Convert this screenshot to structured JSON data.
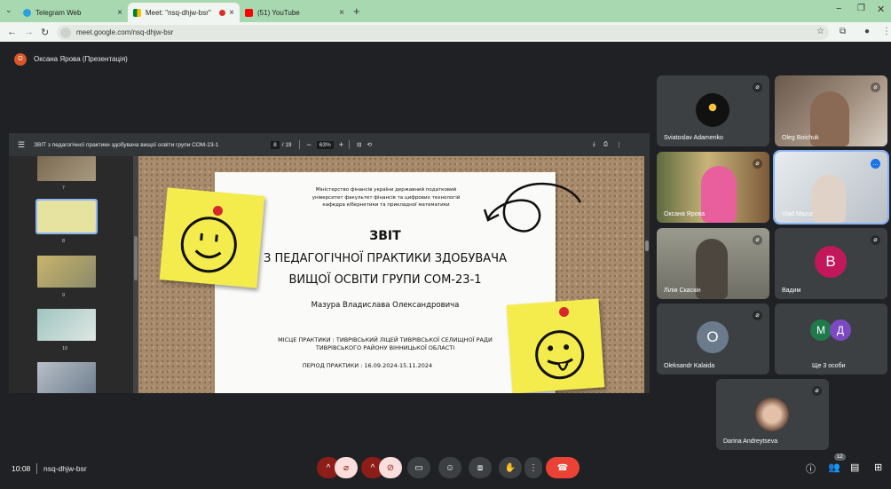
{
  "browser": {
    "tabs": [
      {
        "label": "Telegram Web",
        "icon": "telegram-icon",
        "color": "#2aa1da"
      },
      {
        "label": "Meet: \"nsq-dhjw-bsr\"",
        "icon": "meet-icon",
        "color": "#00832d"
      },
      {
        "label": "(51) YouTube",
        "icon": "youtube-icon",
        "color": "#ff0000"
      }
    ],
    "url": "meet.google.com/nsq-dhjw-bsr"
  },
  "meet": {
    "presenter_initial": "О",
    "presenter_label": "Оксана Ярова (Презентація)",
    "clock": "10:08",
    "meeting_code": "nsq-dhjw-bsr",
    "people_count": "12",
    "participants": [
      {
        "name": "Sviatoslav Adamenko",
        "kind": "avatar"
      },
      {
        "name": "Oleg Boichuk",
        "kind": "video"
      },
      {
        "name": "Оксана Ярова",
        "kind": "video"
      },
      {
        "name": "Vlad Mazur",
        "kind": "video"
      },
      {
        "name": "Лілія Скаскін",
        "kind": "video"
      },
      {
        "name": "Вадим",
        "kind": "letter",
        "letter": "В",
        "color": "#c2185b"
      },
      {
        "name": "Oleksandr Kalaida",
        "kind": "letter",
        "letter": "O",
        "color": "#6b7b8c"
      },
      {
        "name": "Ще 3 особи",
        "kind": "group",
        "letters": [
          "М",
          "Д"
        ]
      },
      {
        "name": "Darina Andreytseva",
        "kind": "avatar"
      }
    ]
  },
  "pdf": {
    "title": "ЗВІТ з педагогічної практики здобувача вищої освіти групи СОМ-23-1",
    "page_current": "8",
    "page_total": "/ 19",
    "zoom": "63%",
    "thumb_pages": [
      "7",
      "8",
      "9",
      "10"
    ]
  },
  "slide": {
    "header": "Міністерство фінансів україни державний податковий університет факультет фінансів та цифрових технологій кафедра кібернетики та прикладної математики",
    "title": [
      "ЗВІТ",
      "З ПЕДАГОГІЧНОЇ ПРАКТИКИ ЗДОБУВАЧА",
      "ВИЩОЇ ОСВІТИ ГРУПИ СОМ-23-1"
    ],
    "student": "Мазура Владислава Олександровича",
    "place_lines": [
      "МІСЦЕ ПРАКТИКИ : ТИВРІВСЬКИЙ ЛІЦЕЙ ТИВРІВСЬКОЇ СЕЛИЩНОЇ РАДИ",
      "ТИВРІВСЬКОГО РАЙОНУ ВІННИЦЬКОЇ ОБЛАСТІ"
    ],
    "period": "ПЕРІОД ПРАКТИКИ : 16.09.2024-15.11.2024"
  }
}
